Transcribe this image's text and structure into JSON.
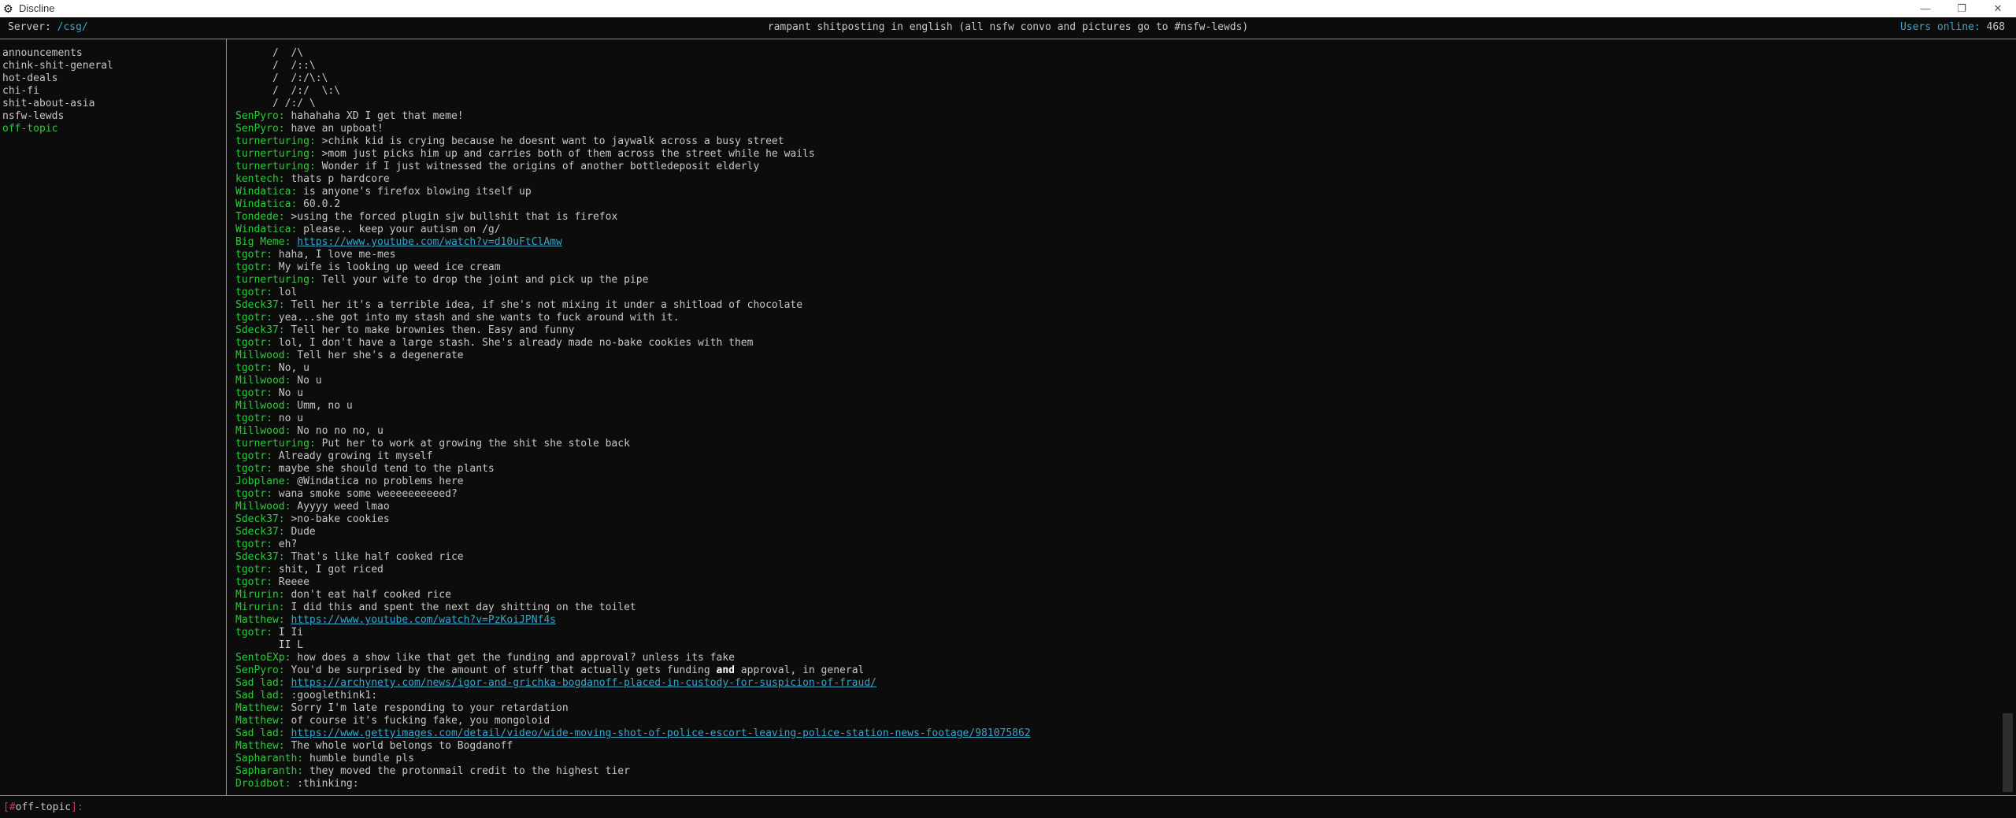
{
  "window": {
    "title": "Discline"
  },
  "header": {
    "server_label": "Server: ",
    "server_name": "/csg/",
    "topic": "rampant shitposting in english (all nsfw convo and pictures go to #nsfw-lewds)",
    "users_label": "Users online: ",
    "users_count": "468"
  },
  "sidebar": {
    "channels": [
      {
        "name": "announcements"
      },
      {
        "name": "chink-shit-general"
      },
      {
        "name": "hot-deals"
      },
      {
        "name": "chi-fi"
      },
      {
        "name": "shit-about-asia"
      },
      {
        "name": "nsfw-lewds"
      },
      {
        "name": "off-topic",
        "active": true
      }
    ]
  },
  "messages": [
    {
      "author": "",
      "text": "      /  /\\"
    },
    {
      "author": "",
      "text": "      /  /::\\"
    },
    {
      "author": "",
      "text": "      /  /:/\\:\\"
    },
    {
      "author": "",
      "text": "      /  /:/  \\:\\"
    },
    {
      "author": "",
      "text": "      / /:/ \\"
    },
    {
      "author": "SenPyro",
      "text": "hahahaha XD I get that meme!"
    },
    {
      "author": "SenPyro",
      "text": "have an upboat!"
    },
    {
      "author": "turnerturing",
      "text": ">chink kid is crying because he doesnt want to jaywalk across a busy street"
    },
    {
      "author": "turnerturing",
      "text": ">mom just picks him up and carries both of them across the street while he wails"
    },
    {
      "author": "turnerturing",
      "text": "Wonder if I just witnessed the origins of another bottledeposit elderly"
    },
    {
      "author": "kentech",
      "text": "thats p hardcore"
    },
    {
      "author": "Windatica",
      "text": "is anyone's firefox blowing itself up"
    },
    {
      "author": "Windatica",
      "text": "60.0.2"
    },
    {
      "author": "Tondede",
      "text": ">using the forced plugin sjw bullshit that is firefox"
    },
    {
      "author": "Windatica",
      "text": "please.. keep your autism on /g/"
    },
    {
      "author": "Big Meme",
      "link": "https://www.youtube.com/watch?v=d10uFtClAmw"
    },
    {
      "author": "tgotr",
      "text": "haha, I love me-mes"
    },
    {
      "author": "tgotr",
      "text": "My wife is looking up weed ice cream"
    },
    {
      "author": "turnerturing",
      "text": "Tell your wife to drop the joint and pick up the pipe"
    },
    {
      "author": "tgotr",
      "text": "lol"
    },
    {
      "author": "Sdeck37",
      "text": "Tell her it's a terrible idea, if she's not mixing it under a shitload of chocolate"
    },
    {
      "author": "tgotr",
      "text": "yea...she got into my stash and she wants to fuck around with it."
    },
    {
      "author": "Sdeck37",
      "text": "Tell her to make brownies then. Easy and funny"
    },
    {
      "author": "tgotr",
      "text": "lol, I don't have a large stash. She's already made no-bake cookies with them"
    },
    {
      "author": "Millwood",
      "text": "Tell her she's a degenerate"
    },
    {
      "author": "tgotr",
      "text": "No, u"
    },
    {
      "author": "Millwood",
      "text": "No u"
    },
    {
      "author": "tgotr",
      "text": "No u"
    },
    {
      "author": "Millwood",
      "text": "Umm, no u"
    },
    {
      "author": "tgotr",
      "text": "no u"
    },
    {
      "author": "Millwood",
      "text": "No no no no, u"
    },
    {
      "author": "turnerturing",
      "text": "Put her to work at growing the shit she stole back"
    },
    {
      "author": "tgotr",
      "text": "Already growing it myself"
    },
    {
      "author": "tgotr",
      "text": "maybe she should tend to the plants"
    },
    {
      "author": "Jobplane",
      "text": "@Windatica no problems here"
    },
    {
      "author": "tgotr",
      "text": "wana smoke some weeeeeeeeeed?"
    },
    {
      "author": "Millwood",
      "text": "Ayyyy weed lmao"
    },
    {
      "author": "Sdeck37",
      "text": ">no-bake cookies"
    },
    {
      "author": "Sdeck37",
      "text": "Dude"
    },
    {
      "author": "tgotr",
      "text": "eh?"
    },
    {
      "author": "Sdeck37",
      "text": "That's like half cooked rice"
    },
    {
      "author": "tgotr",
      "text": "shit, I got riced"
    },
    {
      "author": "tgotr",
      "text": "Reeee"
    },
    {
      "author": "Mirurin",
      "text": "don't eat half cooked rice"
    },
    {
      "author": "Mirurin",
      "text": "I did this and spent the next day shitting on the toilet"
    },
    {
      "author": "Matthew",
      "link": "https://www.youtube.com/watch?v=PzKoiJPNf4s"
    },
    {
      "author": "tgotr",
      "text": "I Ii"
    },
    {
      "author": "",
      "text": "       II L"
    },
    {
      "author": "SentoEXp",
      "text": "how does a show like that get the funding and approval? unless its fake"
    },
    {
      "author": "SenPyro",
      "text": "You'd be surprised by the amount of stuff that actually gets funding ",
      "bold": "and",
      "after": " approval, in general"
    },
    {
      "author": "Sad lad",
      "link": "https://archynety.com/news/igor-and-grichka-bogdanoff-placed-in-custody-for-suspicion-of-fraud/"
    },
    {
      "author": "Sad lad",
      "text": ":googlethink1:"
    },
    {
      "author": "Matthew",
      "text": "Sorry I'm late responding to your retardation"
    },
    {
      "author": "Matthew",
      "text": "of course it's fucking fake, you mongoloid"
    },
    {
      "author": "Sad lad",
      "link": "https://www.gettyimages.com/detail/video/wide-moving-shot-of-police-escort-leaving-police-station-news-footage/981075862"
    },
    {
      "author": "Matthew",
      "text": "The whole world belongs to Bogdanoff"
    },
    {
      "author": "Sapharanth",
      "text": "humble bundle pls"
    },
    {
      "author": "Sapharanth",
      "text": "they moved the protonmail credit to the highest tier"
    },
    {
      "author": "Droidbot",
      "text": ":thinking:"
    }
  ],
  "input": {
    "open": "[",
    "hash": "#",
    "channel": "off-topic",
    "close": "]:"
  },
  "colors": {
    "author": "#2ec93a",
    "link": "#3aa5c8",
    "text": "#c6c6c6",
    "prompt": "#c0357a",
    "background": "#0c0c0c"
  }
}
